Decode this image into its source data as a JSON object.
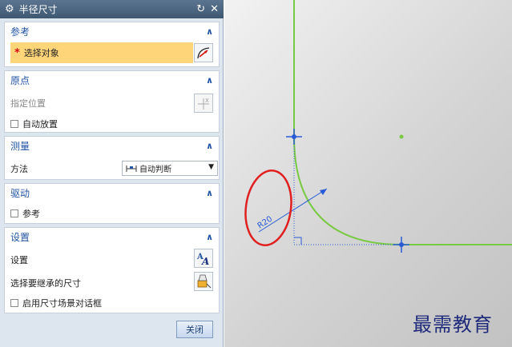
{
  "dialog": {
    "title": "半径尺寸",
    "icons": {
      "gear": "gear-icon",
      "reset": "reset-icon",
      "close": "close-icon"
    },
    "groups": {
      "reference": {
        "header": "参考",
        "select_object": "选择对象",
        "required_mark": "*"
      },
      "origin": {
        "header": "原点",
        "specify_location": "指定位置",
        "auto_place": "自动放置"
      },
      "measure": {
        "header": "测量",
        "method_label": "方法",
        "method_value": "自动判断"
      },
      "drive": {
        "header": "驱动",
        "reference_checkbox": "参考"
      },
      "settings": {
        "header": "设置",
        "settings_label": "设置",
        "inherit_label": "选择要继承的尺寸",
        "enable_dialog": "启用尺寸场景对话框"
      }
    },
    "close_button": "关闭"
  },
  "canvas": {
    "dimension_text": "R20",
    "watermark": "最需教育",
    "colors": {
      "curve": "#7ac943",
      "dimension": "#2a5bd7",
      "highlight": "#e02020"
    }
  }
}
